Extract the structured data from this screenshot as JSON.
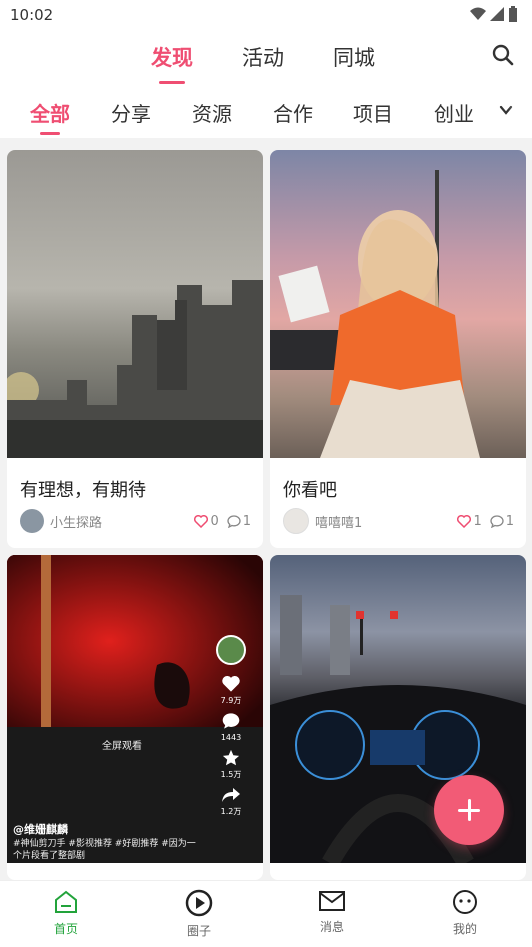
{
  "status": {
    "time": "10:02"
  },
  "tabs": [
    {
      "label": "发现"
    },
    {
      "label": "活动"
    },
    {
      "label": "同城"
    }
  ],
  "categories": [
    {
      "label": "全部"
    },
    {
      "label": "分享"
    },
    {
      "label": "资源"
    },
    {
      "label": "合作"
    },
    {
      "label": "项目"
    },
    {
      "label": "创业"
    }
  ],
  "cards": [
    {
      "title": "有理想，有期待",
      "author": "小生探路",
      "likes": "0",
      "comments": "1"
    },
    {
      "title": "你看吧",
      "author": "嘻嘻嘻1",
      "likes": "1",
      "comments": "1"
    },
    {
      "title": "",
      "author": "",
      "likes": "",
      "comments": ""
    },
    {
      "title": "",
      "author": "",
      "likes": "",
      "comments": ""
    }
  ],
  "video_overlay": {
    "fullscreen": "全屏观看",
    "user": "@维姗麒麟",
    "desc": "#神仙剪刀手 #影视推荐 #好剧推荐 #因为一个片段看了整部剧",
    "likes": "7.9万",
    "comments": "1443",
    "favorites": "1.5万",
    "shares": "1.2万"
  },
  "bottom_nav": [
    {
      "label": "首页"
    },
    {
      "label": "圈子"
    },
    {
      "label": "消息"
    },
    {
      "label": "我的"
    }
  ],
  "colors": {
    "accent": "#ef4e72",
    "nav_active": "#22a33b"
  }
}
